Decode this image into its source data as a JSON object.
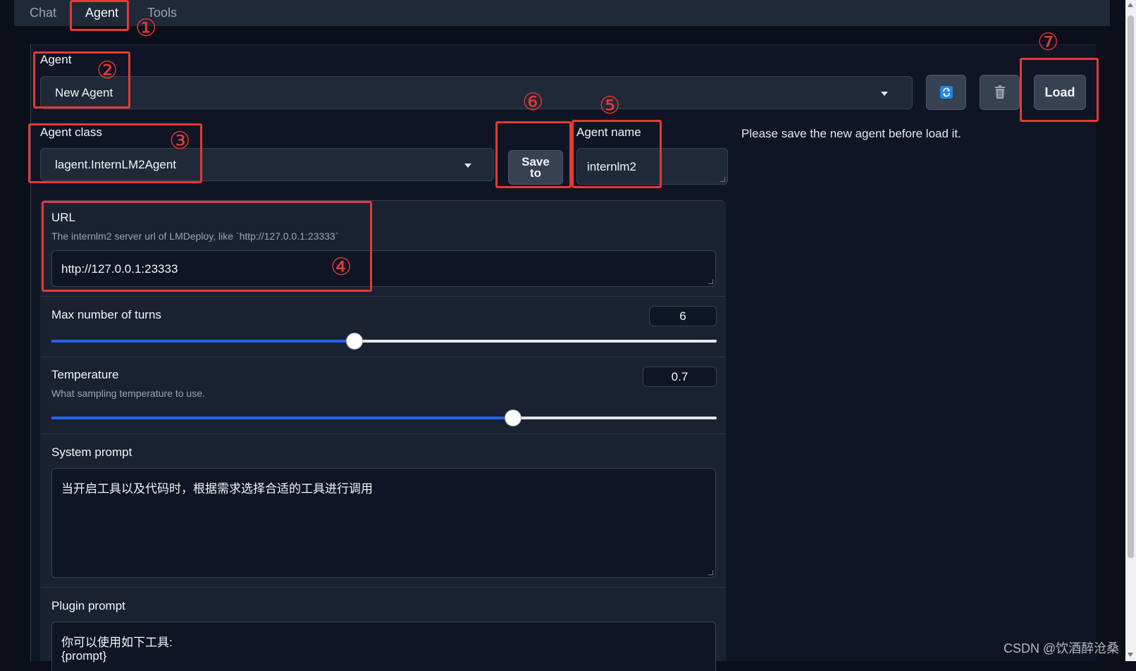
{
  "tabs": [
    {
      "label": "Chat"
    },
    {
      "label": "Agent"
    },
    {
      "label": "Tools"
    }
  ],
  "agent": {
    "label": "Agent",
    "selected": "New Agent",
    "refresh_icon": "refresh-icon",
    "delete_icon": "trash-icon",
    "load_label": "Load"
  },
  "agent_class": {
    "label": "Agent class",
    "selected": "lagent.InternLM2Agent"
  },
  "save_button": {
    "label_line1": "Save",
    "label_line2": "to"
  },
  "agent_name": {
    "label": "Agent name",
    "value": "internlm2"
  },
  "status_message": "Please save the new agent before load it.",
  "url": {
    "label": "URL",
    "hint": "The internlm2 server url of LMDeploy, like `http://127.0.0.1:23333`",
    "value": "http://127.0.0.1:23333"
  },
  "max_turns": {
    "label": "Max number of turns",
    "value": "6",
    "fraction": 0.455
  },
  "temperature": {
    "label": "Temperature",
    "hint": "What sampling temperature to use.",
    "value": "0.7",
    "fraction": 0.694
  },
  "system_prompt": {
    "label": "System prompt",
    "value": "当开启工具以及代码时，根据需求选择合适的工具进行调用"
  },
  "plugin_prompt": {
    "label": "Plugin prompt",
    "value_line1": "你可以使用如下工具:",
    "value_line2": "{prompt}"
  },
  "annotations": [
    "①",
    "②",
    "③",
    "④",
    "⑤",
    "⑥",
    "⑦"
  ],
  "watermark": "CSDN @饮酒醉沧桑",
  "colors": {
    "accent": "#2563eb",
    "annotation": "#e53935",
    "background": "#0b0f19"
  }
}
